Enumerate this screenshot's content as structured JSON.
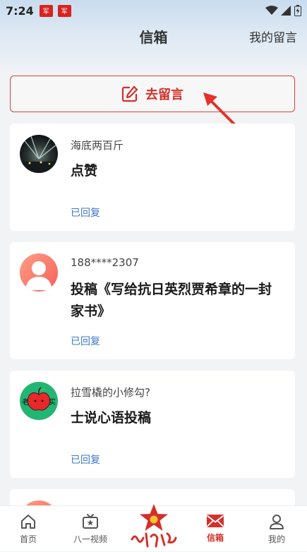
{
  "status_bar": {
    "time": "7:24",
    "app_badge": "军"
  },
  "header": {
    "title": "信箱",
    "right_link": "我的留言"
  },
  "compose": {
    "label": "去留言"
  },
  "messages": [
    {
      "user": "海底两百斤",
      "content": "点赞",
      "status": "已回复",
      "avatar": "night-light-photo"
    },
    {
      "user": "188****2307",
      "content": "投稿《写给抗日英烈贾希章的一封家书》",
      "status": "已回复",
      "avatar": "default-user-avatar"
    },
    {
      "user": "拉雪橇的小修勾?",
      "content": "士说心语投稿",
      "status": "已回复",
      "avatar": "red-apple-avatar",
      "avatar_text": [
        "老",
        "实"
      ]
    }
  ],
  "tabbar": {
    "items": [
      {
        "label": "首页",
        "icon": "home-icon"
      },
      {
        "label": "八一视频",
        "icon": "tv-star-icon"
      },
      {
        "label": "信箱",
        "icon": "mail-icon",
        "active": true
      },
      {
        "label": "我的",
        "icon": "person-icon"
      }
    ],
    "center_logo_text": "解放军报"
  },
  "colors": {
    "accent": "#d4302a",
    "link": "#3f78c3",
    "background": "#f2f3f5"
  }
}
